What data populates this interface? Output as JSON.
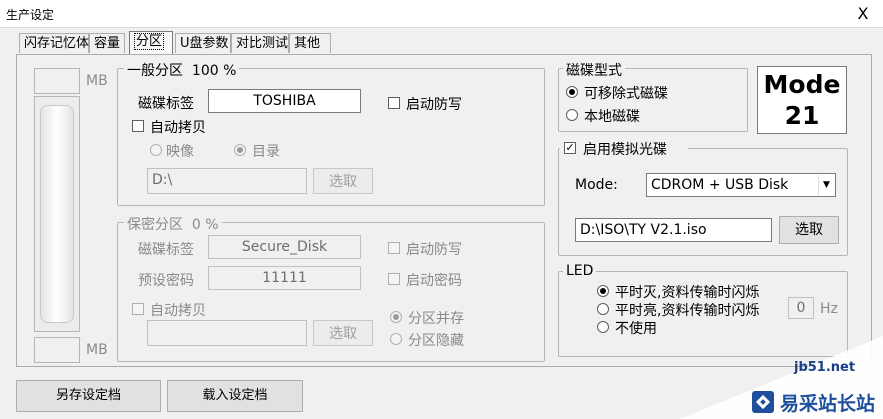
{
  "window": {
    "title": "生产设定",
    "close_label": "X"
  },
  "tabs": [
    {
      "label": "闪存记忆体"
    },
    {
      "label": "容量"
    },
    {
      "label": "分区",
      "active": true
    },
    {
      "label": "U盘参数"
    },
    {
      "label": "对比测试"
    },
    {
      "label": "其他"
    }
  ],
  "capacity": {
    "top_unit": "MB",
    "bottom_unit": "MB"
  },
  "general_partition": {
    "title": "一般分区",
    "percent": "100 %",
    "disk_label_caption": "磁碟标签",
    "disk_label_value": "TOSHIBA",
    "write_protect_label": "启动防写",
    "auto_copy_label": "自动拷贝",
    "image_label": "映像",
    "directory_label": "目录",
    "path_value": "D:\\",
    "select_label": "选取"
  },
  "secure_partition": {
    "title": "保密分区",
    "percent": "0 %",
    "disk_label_caption": "磁碟标签",
    "disk_label_value": "Secure_Disk",
    "write_protect_label": "启动防写",
    "preset_password_caption": "预设密码",
    "preset_password_value": "11111",
    "enable_password_label": "启动密码",
    "auto_copy_label": "自动拷贝",
    "path_value": "",
    "select_label": "选取",
    "coexist_label": "分区并存",
    "hide_label": "分区隐藏"
  },
  "disk_type": {
    "title": "磁碟型式",
    "removable_label": "可移除式磁碟",
    "local_label": "本地磁碟"
  },
  "mode_badge": {
    "line1": "Mode",
    "line2": "21"
  },
  "cdrom": {
    "enable_label": "启用模拟光碟",
    "mode_caption": "Mode:",
    "mode_value": "CDROM + USB Disk",
    "iso_path": "D:\\ISO\\TY V2.1.iso",
    "select_label": "选取"
  },
  "led": {
    "title": "LED",
    "option1": "平时灭,资料传输时闪烁",
    "option2": "平时亮,资料传输时闪烁",
    "option3": "不使用",
    "freq_value": "0",
    "freq_unit": "Hz"
  },
  "footer": {
    "save_label": "另存设定档",
    "load_label": "载入设定档"
  },
  "watermark": {
    "site": "jb51.net",
    "brand": "易采站长站"
  }
}
